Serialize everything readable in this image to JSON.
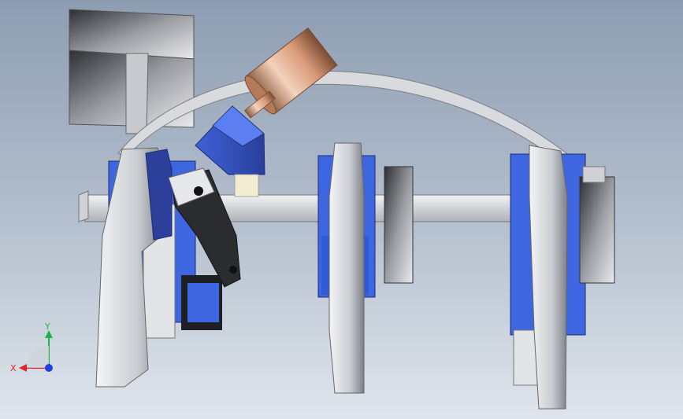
{
  "viewport": {
    "background_top": "#8e9db2",
    "background_bottom": "#dfe5ec",
    "part_colors": {
      "gray_light": "#e6e7ea",
      "gray_mid": "#b9bcc2",
      "gray_dark": "#5b5e64",
      "blue": "#4a6fe3",
      "blue_dark": "#2c3f9a",
      "copper": "#e8b597",
      "black": "#1e1f22"
    }
  },
  "triad": {
    "x_label": "X",
    "y_label": "Y",
    "x_color": "#e0242a",
    "y_color": "#22b24c",
    "z_color": "#2040e0"
  }
}
